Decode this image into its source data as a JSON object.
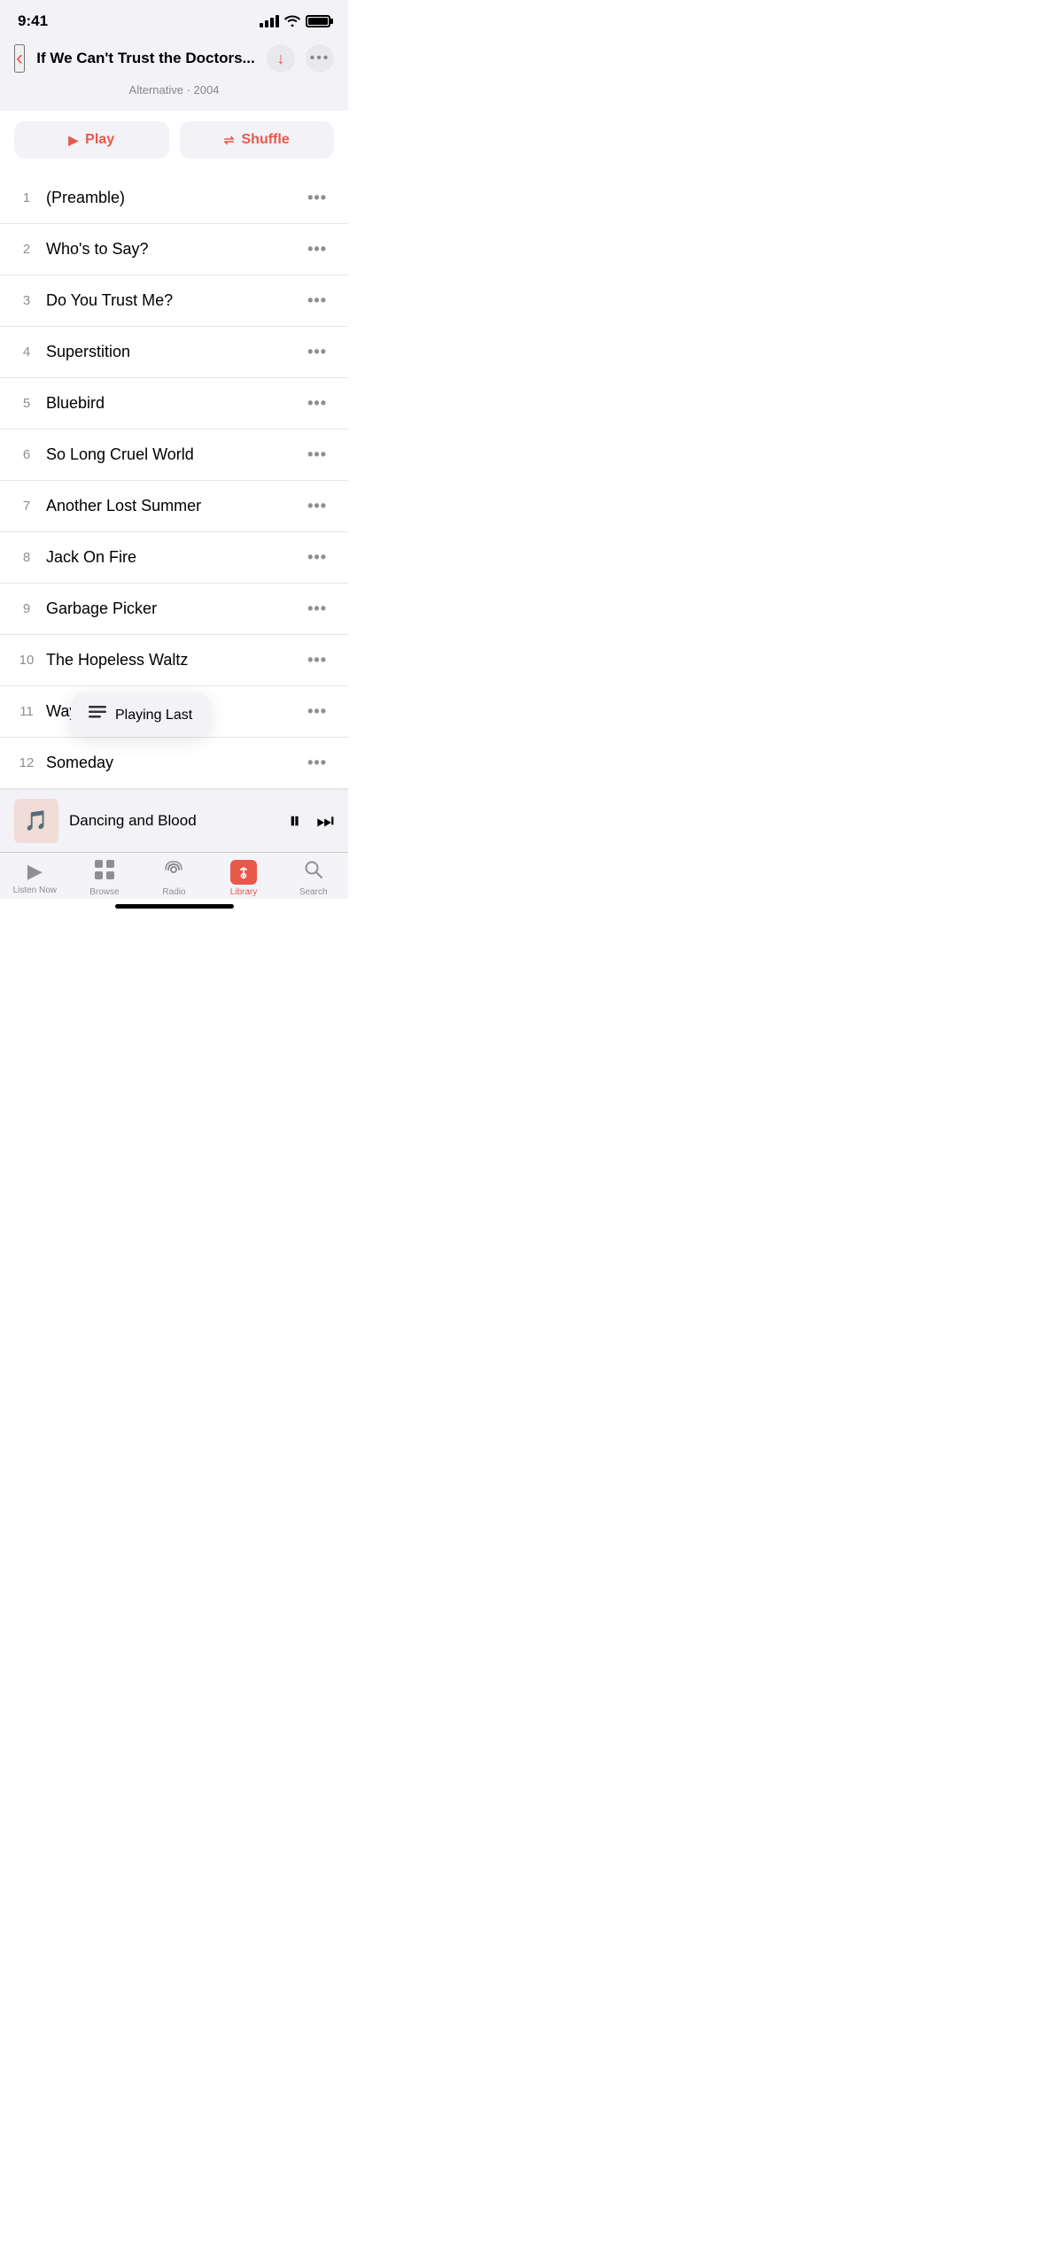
{
  "statusBar": {
    "time": "9:41",
    "batteryFull": true
  },
  "header": {
    "backLabel": "‹",
    "title": "If We Can't Trust the Doctors...",
    "subtitle": "Alternative · 2004"
  },
  "actionButtons": {
    "play": "Play",
    "shuffle": "Shuffle"
  },
  "tracks": [
    {
      "number": "1",
      "name": "(Preamble)"
    },
    {
      "number": "2",
      "name": "Who's to Say?"
    },
    {
      "number": "3",
      "name": "Do You Trust Me?"
    },
    {
      "number": "4",
      "name": "Superstition"
    },
    {
      "number": "5",
      "name": "Bluebird"
    },
    {
      "number": "6",
      "name": "So Long Cruel World"
    },
    {
      "number": "7",
      "name": "Another Lost Summer"
    },
    {
      "number": "8",
      "name": "Jack On Fire"
    },
    {
      "number": "9",
      "name": "Garbage Picker"
    },
    {
      "number": "10",
      "name": "The Hopeless Waltz"
    },
    {
      "number": "11",
      "name": "Wayfaring Str..."
    },
    {
      "number": "12",
      "name": "Someday"
    }
  ],
  "tooltip": {
    "label": "Playing Last"
  },
  "nowPlaying": {
    "title": "Dancing and Blood"
  },
  "tabs": [
    {
      "id": "listen-now",
      "label": "Listen Now",
      "active": false
    },
    {
      "id": "browse",
      "label": "Browse",
      "active": false
    },
    {
      "id": "radio",
      "label": "Radio",
      "active": false
    },
    {
      "id": "library",
      "label": "Library",
      "active": true
    },
    {
      "id": "search",
      "label": "Search",
      "active": false
    }
  ]
}
